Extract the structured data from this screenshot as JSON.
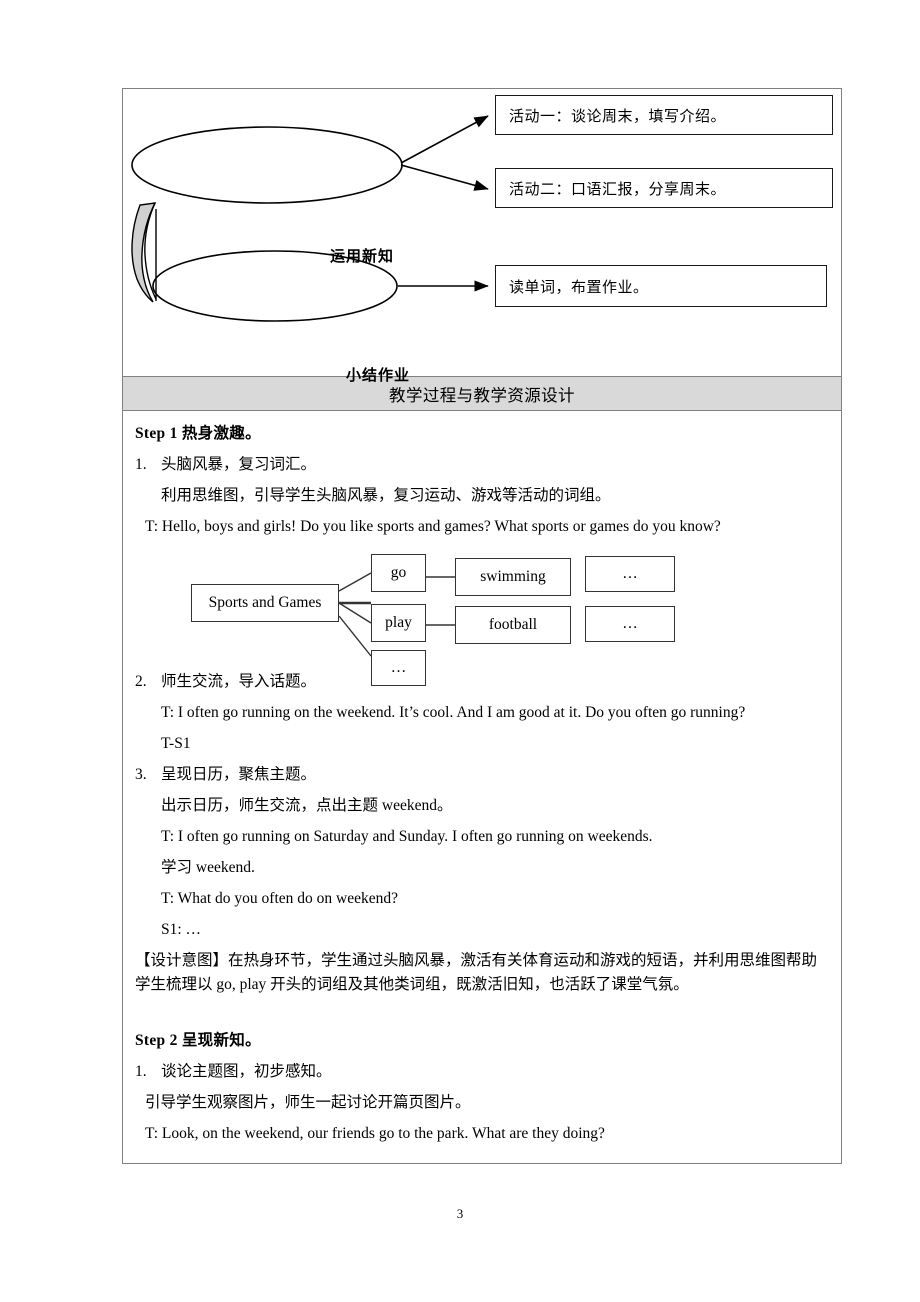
{
  "page": {
    "number": "3"
  },
  "diagram": {
    "ellipses": [
      {
        "label": "运用新知"
      },
      {
        "label": "小结作业"
      }
    ],
    "boxes": [
      {
        "label": "活动一：谈论周末，填写介绍。"
      },
      {
        "label": "活动二：口语汇报，分享周末。"
      },
      {
        "label": "读单词，布置作业。"
      }
    ]
  },
  "section": {
    "header_title": "教学过程与教学资源设计"
  },
  "step1": {
    "heading": "Step 1  热身激趣。",
    "item1_num": "1.",
    "item1_title": "头脑风暴，复习词汇。",
    "item1_detail": "利用思维图，引导学生头脑风暴，复习运动、游戏等活动的词组。",
    "item1_teacher": "T: Hello, boys and girls! Do you like sports and games? What sports or games do you know?",
    "item2_num": "2.",
    "item2_title": "师生交流，导入话题。",
    "item2_teacher": "T: I often go running on the weekend. It’s cool. And I am good at it. Do you often go running?",
    "item2_ts": "T-S1",
    "item3_num": "3.",
    "item3_title": "呈现日历，聚焦主题。",
    "item3_detail": "出示日历，师生交流，点出主题 weekend。",
    "item3_teacher1": "T: I often go running on Saturday and Sunday. I often go running on weekends.",
    "item3_study": "学习 weekend.",
    "item3_teacher2": "T: What do you often do on weekend?",
    "item3_student": "S1: …",
    "intent": "【设计意图】在热身环节，学生通过头脑风暴，激活有关体育运动和游戏的短语，并利用思维图帮助学生梳理以 go, play 开头的词组及其他类词组，既激活旧知，也活跃了课堂气氛。"
  },
  "mindmap": {
    "root": "Sports and Games",
    "go": "go",
    "play": "play",
    "dots_branch": "…",
    "swimming": "swimming",
    "football": "football",
    "dots_go": "…",
    "dots_play": "…"
  },
  "step2": {
    "heading": "Step 2  呈现新知。",
    "item1_num": "1.",
    "item1_title": "谈论主题图，初步感知。",
    "item1_detail": "引导学生观察图片，师生一起讨论开篇页图片。",
    "item1_teacher": "T: Look, on the weekend, our friends go to the park. What are they doing?"
  }
}
